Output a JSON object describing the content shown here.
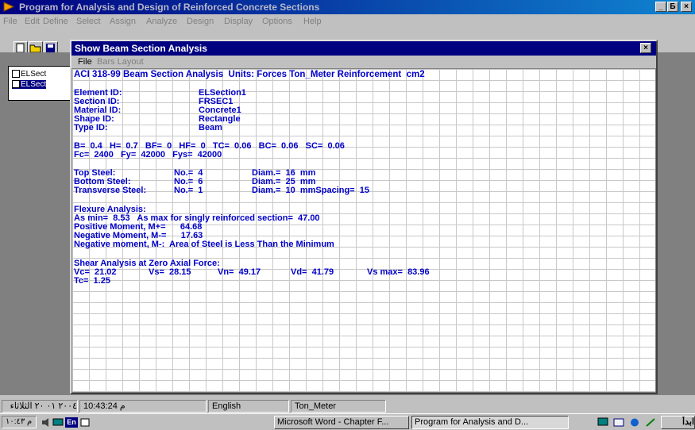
{
  "app": {
    "title": "Program for Analysis and Design of Reinforced Concrete Sections",
    "controls": [
      "_",
      "Б",
      "×"
    ]
  },
  "menu": [
    "File",
    "Edit",
    "Define",
    "Select",
    "Assign",
    "Analyze",
    "Design",
    "Display",
    "Options",
    "Help"
  ],
  "sections_window": {
    "items": [
      "ELSect",
      "ELSect"
    ]
  },
  "dialog": {
    "title": "Show Beam Section Analysis",
    "close": "×",
    "menu": [
      "File",
      "Bars Layout"
    ]
  },
  "report": {
    "header": "ACI 318-99 Beam Section Analysis  Units: Forces Ton_Meter Reinforcement  cm2",
    "ids": [
      {
        "label": "Element ID:",
        "value": "ELSection1"
      },
      {
        "label": "Section ID:",
        "value": "FRSEC1"
      },
      {
        "label": "Material ID:",
        "value": "Concrete1"
      },
      {
        "label": "Shape ID:",
        "value": "Rectangle"
      },
      {
        "label": "Type ID:",
        "value": "Beam"
      }
    ],
    "dims": "B=  0.4   H=  0.7   BF=  0   HF=  0   TC=  0.06   BC=  0.06   SC=  0.06",
    "materials": "Fc=  2400   Fy=  42000   Fys=  42000",
    "steel": [
      {
        "label": "Top Steel:",
        "no": "No.=  4",
        "diam": "Diam.=  16  mm"
      },
      {
        "label": "Bottom Steel:",
        "no": "No.=  6",
        "diam": "Diam.=  25  mm"
      },
      {
        "label": "Transverse Steel:",
        "no": "No.=  1",
        "diam": "Diam.=  10  mmSpacing=  15"
      }
    ],
    "flexure": [
      "Flexure Analysis:",
      "As min=  8.53   As max for singly reinforced section=  47.00",
      "Positive Moment, M+=      64.68",
      "Negative Moment, M-=      17.63",
      "Negative moment, M-:  Area of Steel is Less Than the Minimum"
    ],
    "shear_title": "Shear Analysis at Zero Axial Force:",
    "shear": [
      "Vc=  21.02",
      "Vs=  28.15",
      "Vn=  49.17",
      "Vd=  41.79",
      "Vs max=  83.96"
    ],
    "tc": "Tc=  1.25"
  },
  "status": {
    "date": "٢٠٠٤ ٠١ ٢٠ الثلاثاء",
    "time": "10:43:24 م",
    "language": "English",
    "units": "Ton_Meter"
  },
  "taskbar": {
    "clock": "م ١٠:٤٣",
    "lang_badge": "En",
    "tasks": [
      "Microsoft Word - Chapter F...",
      "Program for Analysis and D..."
    ],
    "start": "ابدأ"
  }
}
